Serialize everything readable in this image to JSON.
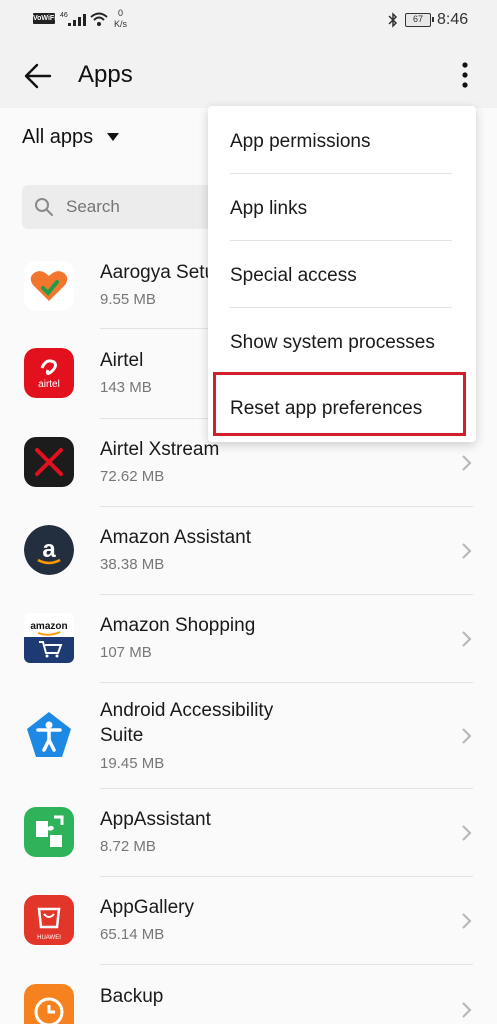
{
  "status_bar": {
    "wifi_label": "VoWiFi",
    "network": "46",
    "speed_value": "0",
    "speed_unit": "K/s",
    "battery": "67",
    "time": "8:46"
  },
  "header": {
    "title": "Apps"
  },
  "filter": {
    "label": "All apps"
  },
  "search": {
    "placeholder": "Search"
  },
  "apps": [
    {
      "name": "Aarogya Setu",
      "size": "9.55 MB"
    },
    {
      "name": "Airtel",
      "size": "143 MB"
    },
    {
      "name": "Airtel Xstream",
      "size": "72.62 MB"
    },
    {
      "name": "Amazon Assistant",
      "size": "38.38 MB"
    },
    {
      "name": "Amazon Shopping",
      "size": "107 MB"
    },
    {
      "name": "Android Accessibility",
      "name2": "Suite",
      "size": "19.45 MB"
    },
    {
      "name": "AppAssistant",
      "size": "8.72 MB"
    },
    {
      "name": "AppGallery",
      "size": "65.14 MB"
    },
    {
      "name": "Backup",
      "size": ""
    }
  ],
  "icon_labels": {
    "airtel": "airtel",
    "amazon": "amazon",
    "huawei": "HUAWEI"
  },
  "menu": {
    "items": [
      "App permissions",
      "App links",
      "Special access",
      "Show system processes",
      "Reset app preferences"
    ]
  },
  "colors": {
    "highlight": "#d0202a",
    "airtel": "#e3101e",
    "amazon_assistant": "#232f3e",
    "amazon_shopping": "#1e3a72",
    "accessibility": "#1e88e5",
    "appassistant": "#2fb35a",
    "appgallery": "#e2362a",
    "backup": "#f5821f"
  }
}
